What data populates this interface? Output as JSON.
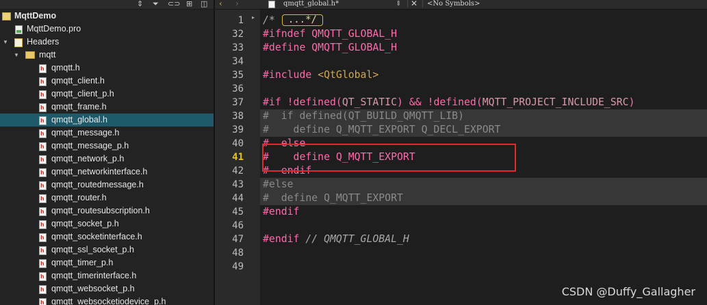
{
  "project_tree": {
    "project_name": "MqttDemo",
    "items": [
      {
        "label": "MqttDemo.pro"
      },
      {
        "label": "Headers"
      },
      {
        "label": "mqtt"
      },
      {
        "label": "qmqtt.h"
      },
      {
        "label": "qmqtt_client.h"
      },
      {
        "label": "qmqtt_client_p.h"
      },
      {
        "label": "qmqtt_frame.h"
      },
      {
        "label": "qmqtt_global.h"
      },
      {
        "label": "qmqtt_message.h"
      },
      {
        "label": "qmqtt_message_p.h"
      },
      {
        "label": "qmqtt_network_p.h"
      },
      {
        "label": "qmqtt_networkinterface.h"
      },
      {
        "label": "qmqtt_routedmessage.h"
      },
      {
        "label": "qmqtt_router.h"
      },
      {
        "label": "qmqtt_routesubscription.h"
      },
      {
        "label": "qmqtt_socket_p.h"
      },
      {
        "label": "qmqtt_socketinterface.h"
      },
      {
        "label": "qmqtt_ssl_socket_p.h"
      },
      {
        "label": "qmqtt_timer_p.h"
      },
      {
        "label": "qmqtt_timerinterface.h"
      },
      {
        "label": "qmqtt_websocket_p.h"
      },
      {
        "label": "qmqtt_websocketiodevice_p.h"
      }
    ],
    "selected": "qmqtt_global.h"
  },
  "editor": {
    "file_tab": "qmqtt_global.h*",
    "symbols_dropdown": "<No Symbols>",
    "current_line": "41",
    "folded_placeholder": "...*/",
    "lines": [
      {
        "num": "1",
        "text": "/*"
      },
      {
        "num": "32",
        "text": "#ifndef QMQTT_GLOBAL_H"
      },
      {
        "num": "33",
        "text": "#define QMQTT_GLOBAL_H"
      },
      {
        "num": "34",
        "text": ""
      },
      {
        "num": "35",
        "text_a": "#include ",
        "text_b": "<QtGlobal>"
      },
      {
        "num": "36",
        "text": ""
      },
      {
        "num": "37",
        "p1": "#if ",
        "p2": "!defined(",
        "p3": "QT_STATIC",
        "p4": ") && ",
        "p5": "!defined(",
        "p6": "MQTT_PROJECT_INCLUDE_SRC",
        "p7": ")"
      },
      {
        "num": "38",
        "text": "#  if defined(QT_BUILD_QMQTT_LIB)"
      },
      {
        "num": "39",
        "text": "#    define Q_MQTT_EXPORT Q_DECL_EXPORT"
      },
      {
        "num": "40",
        "text": "#  else"
      },
      {
        "num": "41",
        "text": "#    define Q_MQTT_EXPORT"
      },
      {
        "num": "42",
        "text": "#  endif"
      },
      {
        "num": "43",
        "text": "#else"
      },
      {
        "num": "44",
        "text": "#  define Q_MQTT_EXPORT"
      },
      {
        "num": "45",
        "text": "#endif"
      },
      {
        "num": "46",
        "text": ""
      },
      {
        "num": "47",
        "text_a": "#endif ",
        "text_b": "// QMQTT_GLOBAL_H"
      },
      {
        "num": "48",
        "text": ""
      },
      {
        "num": "49",
        "text": ""
      }
    ]
  },
  "watermark": "CSDN @Duffy_Gallagher"
}
